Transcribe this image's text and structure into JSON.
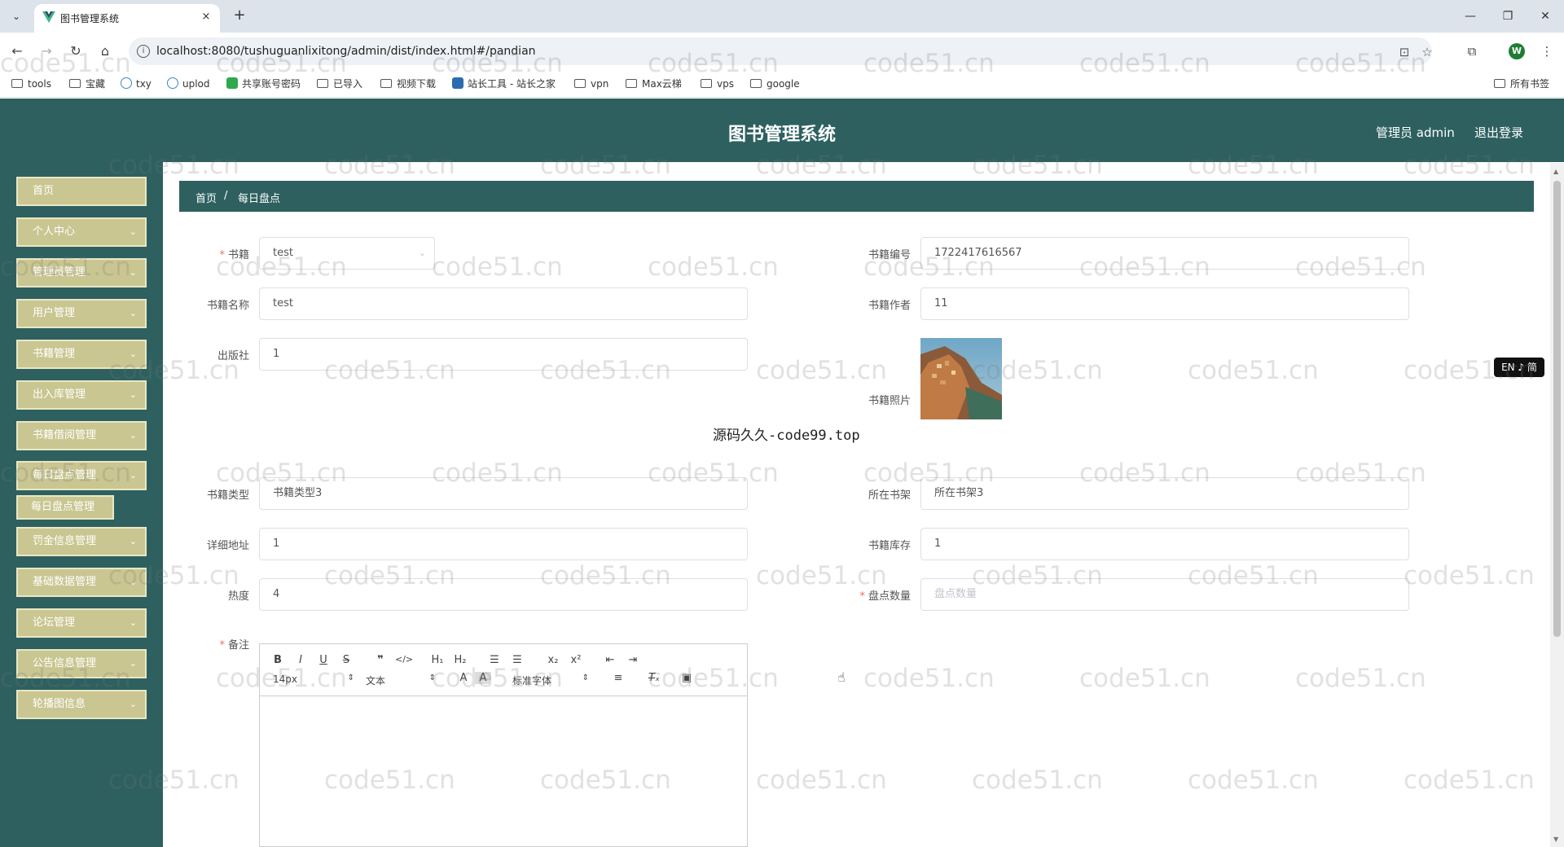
{
  "browser": {
    "tab_title": "图书管理系统",
    "tab_close": "×",
    "new_tab": "+",
    "url": "localhost:8080/tushuguanlixitong/admin/dist/index.html#/pandian",
    "bookmarks": [
      "tools",
      "宝藏",
      "txy",
      "uplod",
      "共享账号密码",
      "已导入",
      "视频下载",
      "站长工具 - 站长之家",
      "vpn",
      "Max云梯",
      "vps",
      "google"
    ],
    "bookmarks_all": "所有书签",
    "profile_letter": "W"
  },
  "header": {
    "title": "图书管理系统",
    "user": "管理员 admin",
    "logout": "退出登录"
  },
  "sidebar": {
    "items": [
      {
        "label": "首页"
      },
      {
        "label": "个人中心"
      },
      {
        "label": "管理员管理"
      },
      {
        "label": "用户管理"
      },
      {
        "label": "书籍管理"
      },
      {
        "label": "出入库管理"
      },
      {
        "label": "书籍借阅管理"
      },
      {
        "label": "每日盘点管理"
      },
      {
        "label": "罚金信息管理"
      },
      {
        "label": "基础数据管理"
      },
      {
        "label": "论坛管理"
      },
      {
        "label": "公告信息管理"
      },
      {
        "label": "轮播图信息"
      }
    ],
    "submenu": "每日盘点管理"
  },
  "breadcrumb": {
    "home": "首页",
    "separator": "/",
    "current": "每日盘点"
  },
  "form": {
    "book_label": "书籍",
    "book_value": "test",
    "book_no_label": "书籍编号",
    "book_no_value": "1722417616567",
    "book_name_label": "书籍名称",
    "book_name_value": "test",
    "author_label": "书籍作者",
    "author_value": "11",
    "publisher_label": "出版社",
    "publisher_value": "1",
    "photo_label": "书籍照片",
    "type_label": "书籍类型",
    "type_value": "书籍类型3",
    "shelf_label": "所在书架",
    "shelf_value": "所在书架3",
    "address_label": "详细地址",
    "address_value": "1",
    "stock_label": "书籍库存",
    "stock_value": "1",
    "heat_label": "热度",
    "heat_value": "4",
    "count_label": "盘点数量",
    "count_placeholder": "盘点数量",
    "note_label": "备注",
    "required_mark": "*"
  },
  "editor": {
    "font_size": "14px",
    "paragraph": "文本",
    "font_family": "标准字体"
  },
  "overlay_text": "源码久久-code99.top",
  "watermark": "code51.cn",
  "lang_badge": "EN ♪ 简"
}
